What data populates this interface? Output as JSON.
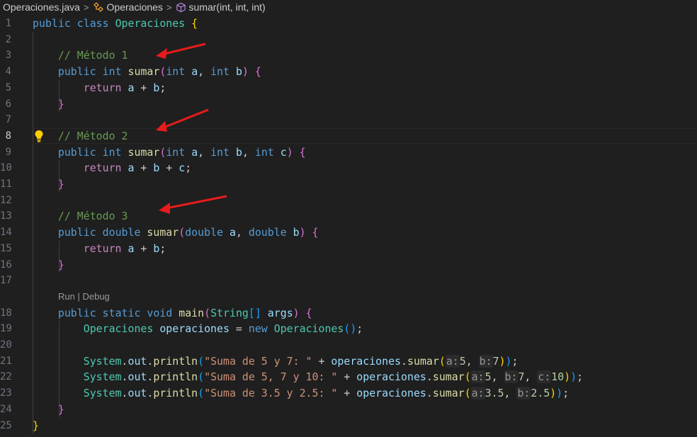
{
  "breadcrumb": {
    "file": "Operaciones.java",
    "class_name": "Operaciones",
    "method": "sumar(int, int, int)",
    "separator": ">"
  },
  "icons": {
    "class": "class-symbol-icon",
    "method": "method-cube-icon",
    "lightbulb": "lightbulb-icon"
  },
  "active_line": 8,
  "codelens": {
    "run": "Run",
    "sep": " | ",
    "debug": "Debug"
  },
  "colors": {
    "background": "#1f1f1f",
    "keyword": "#569cd6",
    "control": "#c586c0",
    "type": "#4ec9b0",
    "function": "#dcdcaa",
    "variable": "#9cdcfe",
    "string": "#ce9178",
    "number": "#b5cea8",
    "comment": "#6a9955",
    "arrow": "#e81b1b"
  },
  "lines": [
    {
      "n": "1",
      "tokens": [
        [
          "kw",
          "public"
        ],
        [
          "",
          ""
        ],
        [
          "",
          " "
        ],
        [
          "kw",
          "class"
        ],
        [
          "",
          " "
        ],
        [
          "ty",
          "Operaciones"
        ],
        [
          "",
          " "
        ],
        [
          "b1",
          "{"
        ]
      ]
    },
    {
      "n": "2",
      "tokens": []
    },
    {
      "n": "3",
      "tokens": [
        [
          "",
          "    "
        ],
        [
          "cm",
          "// Método 1"
        ]
      ]
    },
    {
      "n": "4",
      "tokens": [
        [
          "",
          "    "
        ],
        [
          "kw",
          "public"
        ],
        [
          "",
          " "
        ],
        [
          "kw",
          "int"
        ],
        [
          "",
          " "
        ],
        [
          "fn",
          "sumar"
        ],
        [
          "b2",
          "("
        ],
        [
          "kw",
          "int"
        ],
        [
          "",
          " "
        ],
        [
          "var",
          "a"
        ],
        [
          "",
          ", "
        ],
        [
          "kw",
          "int"
        ],
        [
          "",
          " "
        ],
        [
          "var",
          "b"
        ],
        [
          "b2",
          ")"
        ],
        [
          "",
          " "
        ],
        [
          "b2",
          "{"
        ]
      ]
    },
    {
      "n": "5",
      "tokens": [
        [
          "",
          "        "
        ],
        [
          "kw2",
          "return"
        ],
        [
          "",
          " "
        ],
        [
          "var",
          "a"
        ],
        [
          "",
          " + "
        ],
        [
          "var",
          "b"
        ],
        [
          "",
          ";"
        ]
      ]
    },
    {
      "n": "6",
      "tokens": [
        [
          "",
          "    "
        ],
        [
          "b2",
          "}"
        ]
      ]
    },
    {
      "n": "7",
      "tokens": []
    },
    {
      "n": "8",
      "tokens": [
        [
          "",
          "    "
        ],
        [
          "cm",
          "// Método 2"
        ]
      ]
    },
    {
      "n": "9",
      "tokens": [
        [
          "",
          "    "
        ],
        [
          "kw",
          "public"
        ],
        [
          "",
          " "
        ],
        [
          "kw",
          "int"
        ],
        [
          "",
          " "
        ],
        [
          "fn",
          "sumar"
        ],
        [
          "b2",
          "("
        ],
        [
          "kw",
          "int"
        ],
        [
          "",
          " "
        ],
        [
          "var",
          "a"
        ],
        [
          "",
          ", "
        ],
        [
          "kw",
          "int"
        ],
        [
          "",
          " "
        ],
        [
          "var",
          "b"
        ],
        [
          "",
          ", "
        ],
        [
          "kw",
          "int"
        ],
        [
          "",
          " "
        ],
        [
          "var",
          "c"
        ],
        [
          "b2",
          ")"
        ],
        [
          "",
          " "
        ],
        [
          "b2",
          "{"
        ]
      ]
    },
    {
      "n": "10",
      "tokens": [
        [
          "",
          "        "
        ],
        [
          "kw2",
          "return"
        ],
        [
          "",
          " "
        ],
        [
          "var",
          "a"
        ],
        [
          "",
          " + "
        ],
        [
          "var",
          "b"
        ],
        [
          "",
          " + "
        ],
        [
          "var",
          "c"
        ],
        [
          "",
          ";"
        ]
      ]
    },
    {
      "n": "11",
      "tokens": [
        [
          "",
          "    "
        ],
        [
          "b2",
          "}"
        ]
      ]
    },
    {
      "n": "12",
      "tokens": []
    },
    {
      "n": "13",
      "tokens": [
        [
          "",
          "    "
        ],
        [
          "cm",
          "// Método 3"
        ]
      ]
    },
    {
      "n": "14",
      "tokens": [
        [
          "",
          "    "
        ],
        [
          "kw",
          "public"
        ],
        [
          "",
          " "
        ],
        [
          "kw",
          "double"
        ],
        [
          "",
          " "
        ],
        [
          "fn",
          "sumar"
        ],
        [
          "b2",
          "("
        ],
        [
          "kw",
          "double"
        ],
        [
          "",
          " "
        ],
        [
          "var",
          "a"
        ],
        [
          "",
          ", "
        ],
        [
          "kw",
          "double"
        ],
        [
          "",
          " "
        ],
        [
          "var",
          "b"
        ],
        [
          "b2",
          ")"
        ],
        [
          "",
          " "
        ],
        [
          "b2",
          "{"
        ]
      ]
    },
    {
      "n": "15",
      "tokens": [
        [
          "",
          "        "
        ],
        [
          "kw2",
          "return"
        ],
        [
          "",
          " "
        ],
        [
          "var",
          "a"
        ],
        [
          "",
          " + "
        ],
        [
          "var",
          "b"
        ],
        [
          "",
          ";"
        ]
      ]
    },
    {
      "n": "16",
      "tokens": [
        [
          "",
          "    "
        ],
        [
          "b2",
          "}"
        ]
      ]
    },
    {
      "n": "17",
      "tokens": []
    },
    {
      "n": "18",
      "tokens": [
        [
          "",
          "    "
        ],
        [
          "kw",
          "public"
        ],
        [
          "",
          " "
        ],
        [
          "kw",
          "static"
        ],
        [
          "",
          " "
        ],
        [
          "kw",
          "void"
        ],
        [
          "",
          " "
        ],
        [
          "fn",
          "main"
        ],
        [
          "b2",
          "("
        ],
        [
          "ty",
          "String"
        ],
        [
          "b3",
          "[]"
        ],
        [
          "",
          " "
        ],
        [
          "var",
          "args"
        ],
        [
          "b2",
          ")"
        ],
        [
          "",
          " "
        ],
        [
          "b2",
          "{"
        ]
      ]
    },
    {
      "n": "19",
      "tokens": [
        [
          "",
          "        "
        ],
        [
          "ty",
          "Operaciones"
        ],
        [
          "",
          " "
        ],
        [
          "var",
          "operaciones"
        ],
        [
          "",
          " = "
        ],
        [
          "kw",
          "new"
        ],
        [
          "",
          " "
        ],
        [
          "ty",
          "Operaciones"
        ],
        [
          "b3",
          "()"
        ],
        [
          "",
          ";"
        ]
      ]
    },
    {
      "n": "20",
      "tokens": []
    },
    {
      "n": "21",
      "tokens": [
        [
          "",
          "        "
        ],
        [
          "ty",
          "System"
        ],
        [
          "",
          "."
        ],
        [
          "var",
          "out"
        ],
        [
          "",
          "."
        ],
        [
          "fn",
          "println"
        ],
        [
          "b3",
          "("
        ],
        [
          "str",
          "\"Suma de 5 y 7: \""
        ],
        [
          "",
          " + "
        ],
        [
          "var",
          "operaciones"
        ],
        [
          "",
          "."
        ],
        [
          "fn",
          "sumar"
        ],
        [
          "b1",
          "("
        ],
        [
          "hint",
          "a:"
        ],
        [
          "num",
          "5"
        ],
        [
          "",
          ", "
        ],
        [
          "hint",
          "b:"
        ],
        [
          "num",
          "7"
        ],
        [
          "b1",
          ")"
        ],
        [
          "b3",
          ")"
        ],
        [
          "",
          ";"
        ]
      ]
    },
    {
      "n": "22",
      "tokens": [
        [
          "",
          "        "
        ],
        [
          "ty",
          "System"
        ],
        [
          "",
          "."
        ],
        [
          "var",
          "out"
        ],
        [
          "",
          "."
        ],
        [
          "fn",
          "println"
        ],
        [
          "b3",
          "("
        ],
        [
          "str",
          "\"Suma de 5, 7 y 10: \""
        ],
        [
          "",
          " + "
        ],
        [
          "var",
          "operaciones"
        ],
        [
          "",
          "."
        ],
        [
          "fn",
          "sumar"
        ],
        [
          "b1",
          "("
        ],
        [
          "hint",
          "a:"
        ],
        [
          "num",
          "5"
        ],
        [
          "",
          ", "
        ],
        [
          "hint",
          "b:"
        ],
        [
          "num",
          "7"
        ],
        [
          "",
          ", "
        ],
        [
          "hint",
          "c:"
        ],
        [
          "num",
          "10"
        ],
        [
          "b1",
          ")"
        ],
        [
          "b3",
          ")"
        ],
        [
          "",
          ";"
        ]
      ]
    },
    {
      "n": "23",
      "tokens": [
        [
          "",
          "        "
        ],
        [
          "ty",
          "System"
        ],
        [
          "",
          "."
        ],
        [
          "var",
          "out"
        ],
        [
          "",
          "."
        ],
        [
          "fn",
          "println"
        ],
        [
          "b3",
          "("
        ],
        [
          "str",
          "\"Suma de 3.5 y 2.5: \""
        ],
        [
          "",
          " + "
        ],
        [
          "var",
          "operaciones"
        ],
        [
          "",
          "."
        ],
        [
          "fn",
          "sumar"
        ],
        [
          "b1",
          "("
        ],
        [
          "hint",
          "a:"
        ],
        [
          "num",
          "3.5"
        ],
        [
          "",
          ", "
        ],
        [
          "hint",
          "b:"
        ],
        [
          "num",
          "2.5"
        ],
        [
          "b1",
          ")"
        ],
        [
          "b3",
          ")"
        ],
        [
          "",
          ";"
        ]
      ]
    },
    {
      "n": "24",
      "tokens": [
        [
          "",
          "    "
        ],
        [
          "b2",
          "}"
        ]
      ]
    },
    {
      "n": "25",
      "tokens": [
        [
          "b1",
          "}"
        ]
      ]
    }
  ]
}
